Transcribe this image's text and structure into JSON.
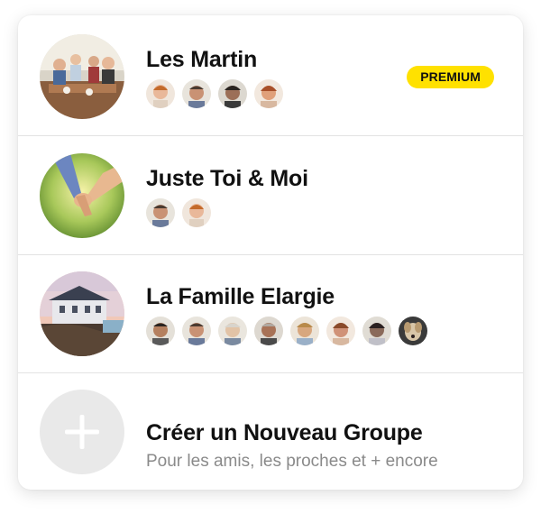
{
  "groups": [
    {
      "name": "Les Martin",
      "badge": "PREMIUM",
      "member_count": 4,
      "member_colors": [
        "#e9b89a",
        "#c99274",
        "#9c6f58",
        "#e0a07a"
      ]
    },
    {
      "name": "Juste Toi & Moi",
      "member_count": 2,
      "member_colors": [
        "#c99274",
        "#e9b89a"
      ]
    },
    {
      "name": "La Famille Elargie",
      "member_count": 8,
      "member_colors": [
        "#b5805f",
        "#c99274",
        "#e2c3a6",
        "#a87256",
        "#d8a77e",
        "#d09278",
        "#8a6a5a",
        "#d8c6a8"
      ]
    }
  ],
  "create": {
    "title": "Créer un Nouveau Groupe",
    "subtitle": "Pour les amis, les proches et + encore"
  },
  "icons": [
    "plus-icon"
  ],
  "colors": {
    "accent": "#ffe100",
    "text": "#111111",
    "muted": "#8a8a8a"
  }
}
